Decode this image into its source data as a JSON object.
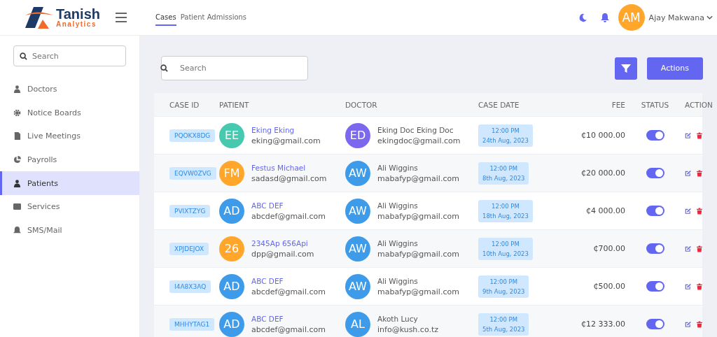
{
  "logo": {
    "name": "Tanish",
    "subtitle": "Analytics"
  },
  "tabs": [
    {
      "label": "Cases",
      "selected": true
    },
    {
      "label": "Patient Admissions",
      "selected": false
    }
  ],
  "user": {
    "initials": "AM",
    "name": "Ajay Makwana"
  },
  "sidebar": {
    "search": {
      "placeholder": "Search"
    },
    "items": [
      {
        "label": "Doctors",
        "selected": false
      },
      {
        "label": "Notice Boards",
        "selected": false
      },
      {
        "label": "Live Meetings",
        "selected": false
      },
      {
        "label": "Payrolls",
        "selected": false
      },
      {
        "label": "Patients",
        "selected": true
      },
      {
        "label": "Services",
        "selected": false
      },
      {
        "label": "SMS/Mail",
        "selected": false
      }
    ]
  },
  "search": {
    "placeholder": "Search"
  },
  "actions_button": "Actions",
  "table": {
    "columns": [
      "CASE ID",
      "PATIENT",
      "DOCTOR",
      "CASE DATE",
      "FEE",
      "STATUS",
      "ACTION"
    ],
    "rows": [
      {
        "case_id": "PQOKX8DG",
        "patient": {
          "initials": "EE",
          "color": "#47c9b0",
          "name": "Eking Eking",
          "email": "eking@gmail.com"
        },
        "doctor": {
          "initials": "ED",
          "color": "#7b68ee",
          "name": "Eking Doc Eking Doc",
          "email": "ekingdoc@gmail.com"
        },
        "time": "12:00 PM",
        "date": "24th Aug, 2023",
        "fee": "₵10 000.00",
        "on": true
      },
      {
        "case_id": "EQVW0ZVG",
        "patient": {
          "initials": "FM",
          "color": "#ffa62b",
          "name": "Festus Michael",
          "email": "sadasd@gmail.com"
        },
        "doctor": {
          "initials": "AW",
          "color": "#3d9be9",
          "name": "Ali Wiggins",
          "email": "mabafyp@gmail.com"
        },
        "time": "12:00 PM",
        "date": "8th Aug, 2023",
        "fee": "₵20 000.00",
        "on": true
      },
      {
        "case_id": "PVIXTZYG",
        "patient": {
          "initials": "AD",
          "color": "#3d9be9",
          "name": "ABC DEF",
          "email": "abcdef@gmail.com"
        },
        "doctor": {
          "initials": "AW",
          "color": "#3d9be9",
          "name": "Ali Wiggins",
          "email": "mabafyp@gmail.com"
        },
        "time": "12:00 PM",
        "date": "18th Aug, 2023",
        "fee": "₵4 000.00",
        "on": true
      },
      {
        "case_id": "XPJDEJOX",
        "patient": {
          "initials": "26",
          "color": "#ffa62b",
          "name": "2345Ap 656Api",
          "email": "dpp@gmail.com"
        },
        "doctor": {
          "initials": "AW",
          "color": "#3d9be9",
          "name": "Ali Wiggins",
          "email": "mabafyp@gmail.com"
        },
        "time": "12:00 PM",
        "date": "10th Aug, 2023",
        "fee": "₵700.00",
        "on": true
      },
      {
        "case_id": "I4A8X3AQ",
        "patient": {
          "initials": "AD",
          "color": "#3d9be9",
          "name": "ABC DEF",
          "email": "abcdef@gmail.com"
        },
        "doctor": {
          "initials": "AW",
          "color": "#3d9be9",
          "name": "Ali Wiggins",
          "email": "mabafyp@gmail.com"
        },
        "time": "12:00 PM",
        "date": "9th Aug, 2023",
        "fee": "₵500.00",
        "on": true
      },
      {
        "case_id": "MHHYTAG1",
        "patient": {
          "initials": "AD",
          "color": "#3d9be9",
          "name": "ABC DEF",
          "email": "abcdef@gmail.com"
        },
        "doctor": {
          "initials": "AL",
          "color": "#3d9be9",
          "name": "Akoth Lucy",
          "email": "info@kush.co.tz"
        },
        "time": "12:00 PM",
        "date": "5th Aug, 2023",
        "fee": "₵12 333.00",
        "on": true
      }
    ]
  }
}
